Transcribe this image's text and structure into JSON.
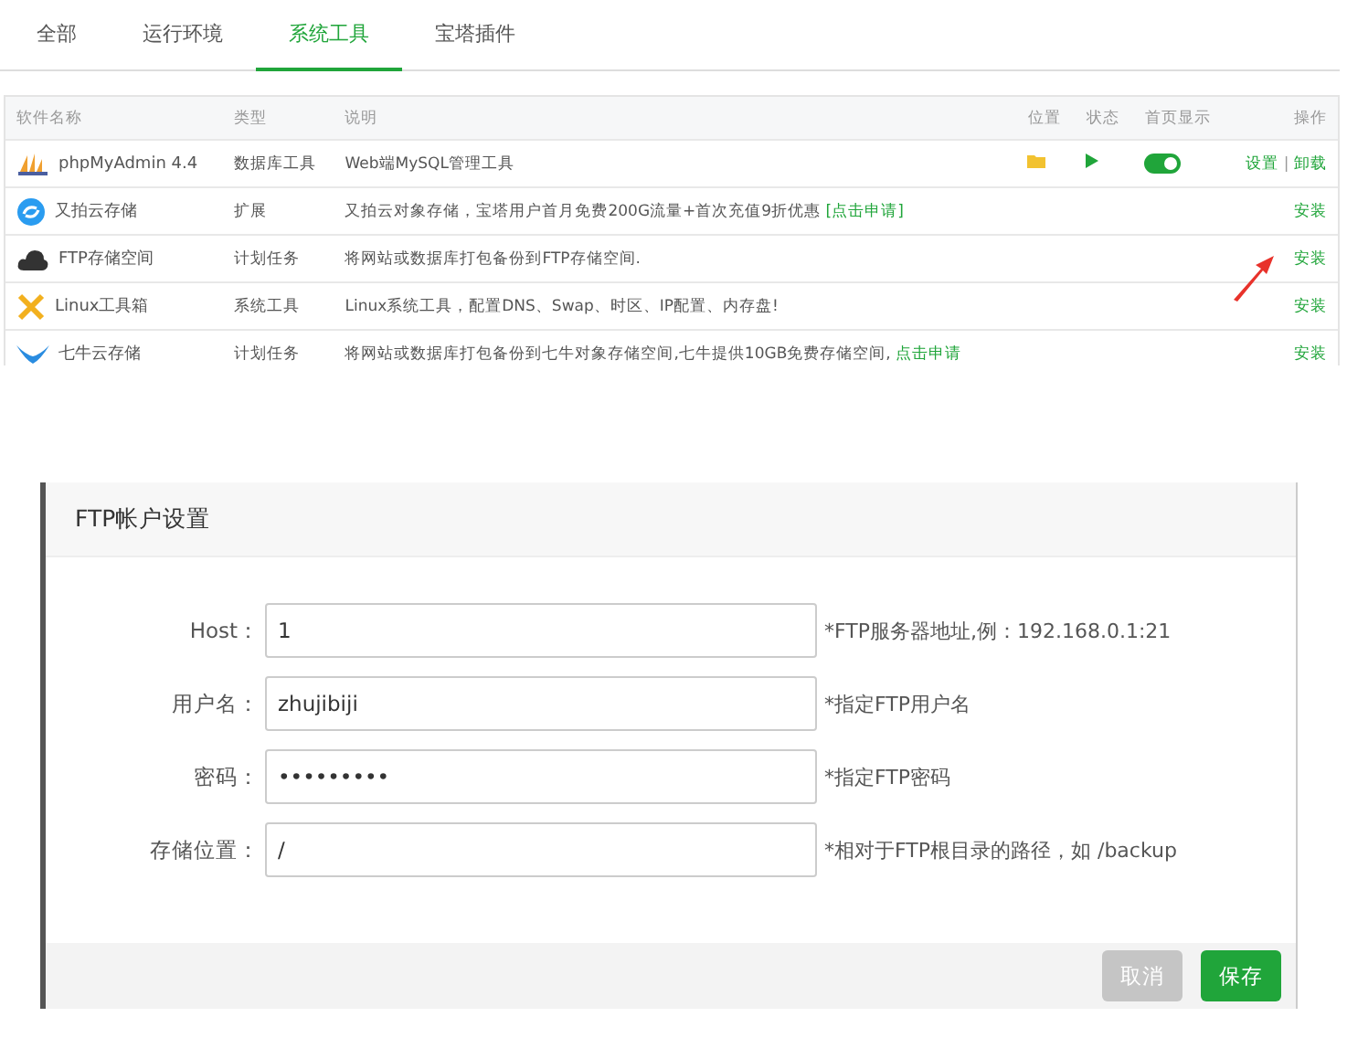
{
  "tabs": [
    {
      "label": "全部",
      "selected": false
    },
    {
      "label": "运行环境",
      "selected": false
    },
    {
      "label": "系统工具",
      "selected": true
    },
    {
      "label": "宝塔插件",
      "selected": false
    }
  ],
  "table": {
    "columns": [
      "软件名称",
      "类型",
      "说明",
      "位置",
      "状态",
      "首页显示",
      "操作"
    ],
    "rows": [
      {
        "name": "phpMyAdmin 4.4",
        "type": "数据库工具",
        "description": "Web端MySQL管理工具",
        "home_display": true,
        "actions": [
          "设置",
          "卸载"
        ],
        "action_separator": "|"
      },
      {
        "name": "又拍云存储",
        "type": "扩展",
        "description": "又拍云对象存储，宝塔用户首月免费200G流量+首次充值9折优惠",
        "link": "[点击申请]",
        "actions": [
          "安装"
        ]
      },
      {
        "name": "FTP存储空间",
        "type": "计划任务",
        "description": "将网站或数据库打包备份到FTP存储空间.",
        "actions": [
          "安装"
        ]
      },
      {
        "name": "Linux工具箱",
        "type": "系统工具",
        "description": "Linux系统工具，配置DNS、Swap、时区、IP配置、内存盘!",
        "actions": [
          "安装"
        ]
      },
      {
        "name": "七牛云存储",
        "type": "计划任务",
        "description": "将网站或数据库打包备份到七牛对象存储空间,七牛提供10GB免费存储空间,",
        "link": "点击申请",
        "actions": [
          "安装"
        ]
      }
    ]
  },
  "dialog": {
    "title": "FTP帐户设置",
    "fields": [
      {
        "label": "Host：",
        "value": "1",
        "hint": "*FTP服务器地址,例：192.168.0.1:21"
      },
      {
        "label": "用户名：",
        "value": "zhujibiji",
        "hint": "*指定FTP用户名"
      },
      {
        "label": "密码：",
        "value": "•••••••••",
        "hint": "*指定FTP密码"
      },
      {
        "label": "存储位置：",
        "value": "/",
        "hint": "*相对于FTP根目录的路径，如 /backup"
      }
    ],
    "buttons": [
      {
        "label": "取消",
        "kind": "cancel"
      },
      {
        "label": "保存",
        "kind": "primary"
      }
    ]
  }
}
